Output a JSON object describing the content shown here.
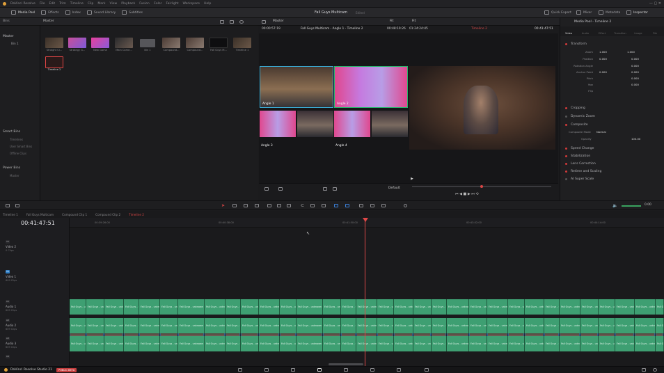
{
  "menubar": {
    "app": "DaVinci Resolve",
    "items": [
      "File",
      "Edit",
      "Trim",
      "Timeline",
      "Clip",
      "Mark",
      "View",
      "Playback",
      "Fusion",
      "Color",
      "Fairlight",
      "Workspace",
      "Help"
    ]
  },
  "topbar": {
    "left": [
      "Media Pool",
      "Effects",
      "Index",
      "Sound Library",
      "Subtitles"
    ],
    "project_title": "Fall Guys Multicam",
    "project_status": "Edited",
    "right": [
      "Quick Export",
      "Mixer",
      "Metadata",
      "Inspector"
    ]
  },
  "bins": {
    "header": "Bins",
    "master": "Master",
    "bin1": "Bin 1",
    "smart_bins": "Smart Bins",
    "smart_items": [
      "Timelines",
      "User Smart Bins",
      "Offline Clips"
    ],
    "power_bins": "Power Bins",
    "power_items": [
      "Master"
    ]
  },
  "media_pool": {
    "path": "Master",
    "thumbnails": [
      "Straight Cl...",
      "Strategy G...",
      "New Game",
      "Main Came...",
      "Bin 1",
      "Compound...",
      "Compound...",
      "Fall Guys M...",
      "Timeline 1",
      "Timeline 2"
    ]
  },
  "viewer": {
    "dropdown": "Master",
    "zoom_left": "Fit",
    "timecode_left": "00:00:57:19",
    "title": "Fall Guys Multicam - Angle 1 - Timeline 2",
    "duration": "00:48:19:26",
    "source_tc": "01:24:24:45",
    "timeline_dd": "Timeline 2",
    "zoom_right": "Fit",
    "timecode_right": "00:41:47:51",
    "angles": [
      "Angle 1",
      "Angle 2",
      "Angle 3",
      "Angle 4"
    ],
    "mode": "Default"
  },
  "inspector": {
    "title": "Media Pool - Timeline 2",
    "tabs": [
      "Video",
      "Audio",
      "Effect",
      "Transition",
      "Image",
      "File"
    ],
    "transform": "Transform",
    "params": [
      {
        "name": "Zoom",
        "x": "1.000",
        "y": "1.000"
      },
      {
        "name": "Position",
        "x": "0.000",
        "y": "0.000"
      },
      {
        "name": "Rotation Angle",
        "x": "",
        "y": "0.000"
      },
      {
        "name": "Anchor Point",
        "x": "0.000",
        "y": "0.000"
      },
      {
        "name": "Pitch",
        "x": "",
        "y": "0.000"
      },
      {
        "name": "Yaw",
        "x": "",
        "y": "0.000"
      },
      {
        "name": "Flip",
        "x": "",
        "y": ""
      }
    ],
    "cropping": "Cropping",
    "dynamic_zoom": "Dynamic Zoom",
    "composite": "Composite",
    "composite_mode_label": "Composite Mode",
    "composite_mode": "Normal",
    "opacity_label": "Opacity",
    "opacity": "100.00",
    "more": [
      "Speed Change",
      "Stabilization",
      "Lens Correction",
      "Retime and Scaling",
      "AI Super Scale"
    ]
  },
  "timeline": {
    "tabs": [
      "Timeline 1",
      "Fall Guys Multicam",
      "Compound Clip 1",
      "Compound Clip 2",
      "Timeline 2"
    ],
    "active_tab": "Timeline 2",
    "timecode": "00:41:47:51",
    "volume": "0.00",
    "ruler": [
      "00:39:26:00",
      "00:40:38:00",
      "00:41:50:00",
      "00:43:02:00",
      "00:44:14:00"
    ],
    "tracks": [
      {
        "id": "V2",
        "name": "Video 2",
        "clips": "0 Clips"
      },
      {
        "id": "V1",
        "name": "Video 1",
        "clips": "609 Clips"
      },
      {
        "id": "A1",
        "name": "Audio 1",
        "clips": "609 Clips"
      },
      {
        "id": "A2",
        "name": "Audio 2",
        "clips": "609 Clips"
      },
      {
        "id": "A3",
        "name": "Audio 3",
        "clips": "609 Clips"
      },
      {
        "id": "A4",
        "name": "Audio 4",
        "clips": ""
      }
    ],
    "video_clip_label": "Fall Guys - Angle 1",
    "audio_clip_label": "Fall Guys - unknown"
  },
  "bottombar": {
    "app": "DaVinci Resolve Studio 21",
    "badge": "PUBLIC BETA"
  }
}
